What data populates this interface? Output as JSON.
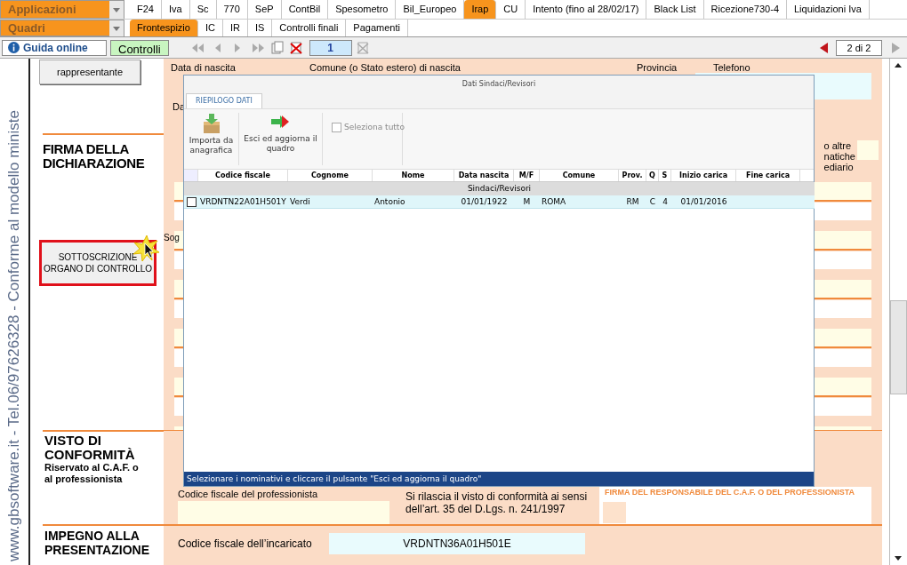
{
  "app_bar": {
    "applicazioni": "Applicazioni",
    "quadri": "Quadri"
  },
  "app_tabs": [
    {
      "label": "F24",
      "selected": false
    },
    {
      "label": "Iva",
      "selected": false
    },
    {
      "label": "Sc",
      "selected": false
    },
    {
      "label": "770",
      "selected": false
    },
    {
      "label": "SeP",
      "selected": false
    },
    {
      "label": "ContBil",
      "selected": false
    },
    {
      "label": "Spesometro",
      "selected": false
    },
    {
      "label": "Bil_Europeo",
      "selected": false
    },
    {
      "label": "Irap",
      "selected": true
    },
    {
      "label": "CU",
      "selected": false
    },
    {
      "label": "Intento (fino al 28/02/17)",
      "selected": false
    },
    {
      "label": "Black List",
      "selected": false
    },
    {
      "label": "Ricezione730-4",
      "selected": false
    },
    {
      "label": "Liquidazioni Iva",
      "selected": false
    }
  ],
  "quadri_tabs": [
    {
      "label": "Frontespizio",
      "selected": true
    },
    {
      "label": "IC",
      "selected": false
    },
    {
      "label": "IR",
      "selected": false
    },
    {
      "label": "IS",
      "selected": false
    },
    {
      "label": "Controlli finali",
      "selected": false
    },
    {
      "label": "Pagamenti",
      "selected": false
    }
  ],
  "toolbar": {
    "help": "Guida online",
    "controls": "Controlli",
    "page": "1",
    "page_count": "2 di 2"
  },
  "side_text": "www.gbsoftware.it - Tel.06/97626328 - Conforme al modello ministe",
  "form": {
    "rappresentante": "rappresentante",
    "labels": [
      "Data di nascita",
      "Comune (o Stato estero) di nascita",
      "Provincia",
      "Telefono"
    ],
    "da": "Da",
    "firma_title": "FIRMA DELLA DICHIARAZIONE",
    "sottoscrizione": "SOTTOSCRIZIONE ORGANO DI CONTROLLO",
    "sog": "Sog",
    "side_note": [
      "o altre",
      "natiche",
      "ediario"
    ],
    "visto_title": "VISTO DI CONFORMITÀ",
    "visto_sub": "Riservato al C.A.F. o al professionista",
    "cf_professionista": "Codice fiscale del professionista",
    "rilascia": [
      "Si rilascia il visto di conformità ai sensi",
      "dell’art. 35 del D.Lgs. n. 241/1997"
    ],
    "firma_responsabile": "FIRMA DEL RESPONSABILE DEL C.A.F. O DEL PROFESSIONISTA",
    "impegno_title": "IMPEGNO ALLA PRESENTAZIONE",
    "cf_incaricato": "Codice fiscale dell’incaricato",
    "cf_incaricato_value": "VRDNTN36A01H501E"
  },
  "dialog": {
    "title": "Dati Sindaci/Revisori",
    "tab": "RIEPILOGO DATI",
    "import": "Importa da anagrafica",
    "exit": "Esci ed aggiorna il quadro",
    "select_all": {
      "label": "Seleziona tutto",
      "checked": false
    },
    "columns": [
      "Codice fiscale",
      "Cognome",
      "Nome",
      "Data nascita",
      "M/F",
      "Comune",
      "Prov.",
      "Q",
      "S",
      "Inizio carica",
      "Fine carica"
    ],
    "group": "Sindaci/Revisori",
    "rows": [
      {
        "checked": false,
        "cells": [
          "VRDNTN22A01H501Y",
          "Verdi",
          "Antonio",
          "01/01/1922",
          "M",
          "ROMA",
          "RM",
          "C",
          "4",
          "01/01/2016",
          ""
        ]
      }
    ],
    "status": "Selezionare i nominativi e cliccare il pulsante \"Esci ed aggiorna il quadro\""
  }
}
